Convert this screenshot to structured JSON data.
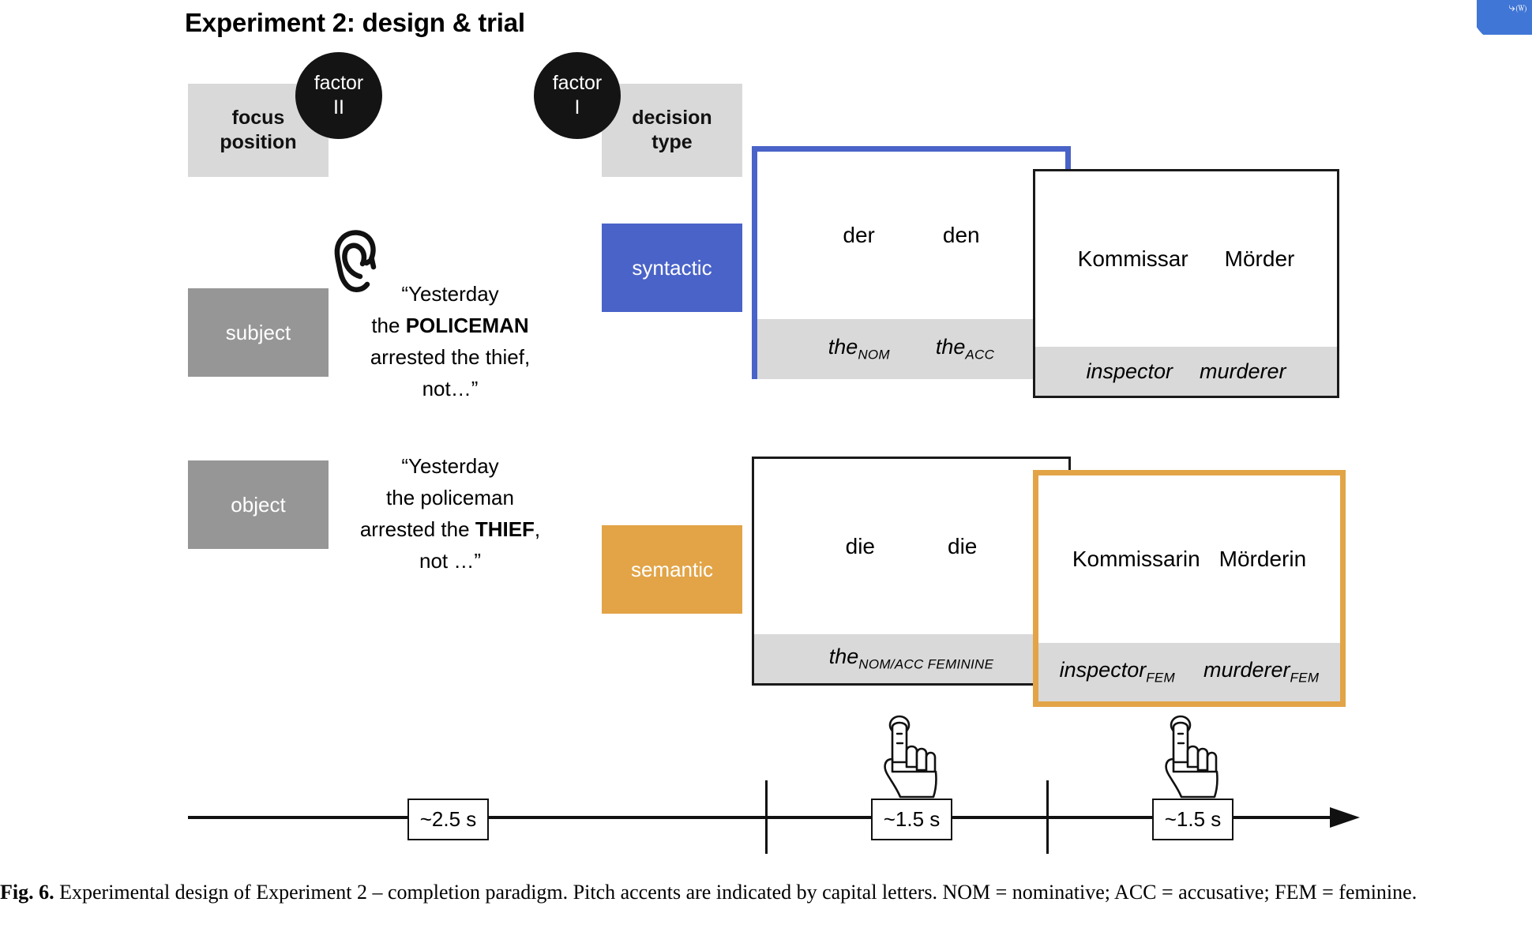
{
  "badge": {
    "name": "word-export-badge",
    "glyphs": "⤷🄦",
    "color": "#4076d6"
  },
  "page_title": "Experiment 2: design & trial",
  "factors": {
    "factor_two": {
      "line1": "factor",
      "line2": "II"
    },
    "factor_one": {
      "line1": "factor",
      "line2": "I"
    }
  },
  "headers": {
    "focus_position": "focus\nposition",
    "focus_position_line1": "focus",
    "focus_position_line2": "position",
    "decision_type_line1": "decision",
    "decision_type_line2": "type"
  },
  "focus_conditions": [
    {
      "label": "subject",
      "quote_line1": "“Yesterday",
      "quote_line2_plain": "the ",
      "quote_line2_accent": "POLICEMAN",
      "quote_line3": "arrested the thief,",
      "quote_line4": "not…”"
    },
    {
      "label": "object",
      "quote_line1": "“Yesterday",
      "quote_line2_plain": "the policeman",
      "quote_line3_plain": "arrested the ",
      "quote_line3_accent": "THIEF",
      "quote_line3_tail": ",",
      "quote_line4": "not …”"
    }
  ],
  "decision_types": [
    {
      "label": "syntactic",
      "color": "#4a63c8"
    },
    {
      "label": "semantic",
      "color": "#e2a447"
    }
  ],
  "stimulus_cards": {
    "syntactic_determiners": {
      "border_color": "#4a63c8",
      "top_left": "der",
      "top_right": "den",
      "gloss_left_base": "the",
      "gloss_left_sub": "NOM",
      "gloss_right_base": "the",
      "gloss_right_sub": "ACC"
    },
    "syntactic_nouns": {
      "border_color": "#1a1a1a",
      "top_left": "Kommissar",
      "top_right": "Mörder",
      "gloss_left_base": "inspector",
      "gloss_left_sub": "",
      "gloss_right_base": "murderer",
      "gloss_right_sub": ""
    },
    "semantic_determiners": {
      "border_color": "#1a1a1a",
      "top_left": "die",
      "top_right": "die",
      "gloss_base": "the",
      "gloss_sub": "NOM/ACC FEMININE"
    },
    "semantic_nouns": {
      "border_color": "#e2a447",
      "top_left": "Kommissarin",
      "top_right": "Mörderin",
      "gloss_left_base": "inspector",
      "gloss_left_sub": "FEM",
      "gloss_right_base": "murderer",
      "gloss_right_sub": "FEM"
    }
  },
  "timeline": {
    "durations": [
      "~2.5 s",
      "~1.5 s",
      "~1.5 s"
    ],
    "hand_icon_name": "pointing-hand-icon"
  },
  "caption": {
    "label": "Fig. 6.",
    "text": " Experimental design of Experiment 2 – completion paradigm. Pitch accents are indicated by capital letters. NOM = nominative; ACC = accusative; FEM = feminine."
  }
}
